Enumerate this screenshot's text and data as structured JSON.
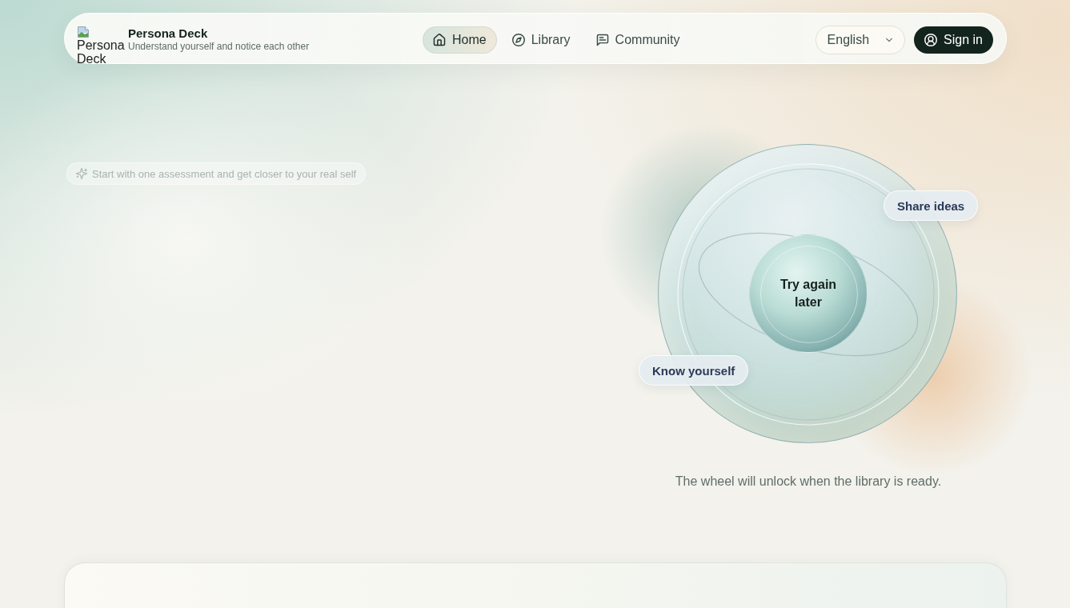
{
  "header": {
    "logo_alt": "Persona Deck",
    "title": "Persona Deck",
    "subtitle": "Understand yourself and notice each other",
    "nav": [
      {
        "label": "Home",
        "selected": true
      },
      {
        "label": "Library",
        "selected": false
      },
      {
        "label": "Community",
        "selected": false
      }
    ],
    "language": "English",
    "sign_in": "Sign in"
  },
  "hero": {
    "badge": "Start with one assessment and get closer to your real self",
    "wheel": {
      "center": "Try again later",
      "tags": [
        "Share ideas",
        "Know yourself"
      ],
      "caption": "The wheel will unlock when the library is ready."
    }
  }
}
